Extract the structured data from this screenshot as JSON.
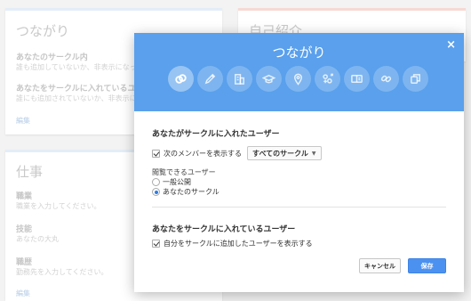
{
  "background": {
    "connections_card": {
      "title": "つながり",
      "sections": [
        {
          "heading": "あなたのサークル内",
          "sub": "誰も追加していないか、非表示になっています"
        },
        {
          "heading": "あなたをサークルに入れているユーザー",
          "sub": "誰にも追加されていないか、非表示になっています"
        }
      ],
      "edit": "編集"
    },
    "intro_card": {
      "title": "自己紹介"
    },
    "work_card": {
      "title": "仕事",
      "fields": [
        {
          "label": "職業",
          "value": "職業を入力してください。"
        },
        {
          "label": "技能",
          "value": "あなたの大丸"
        },
        {
          "label": "職歴",
          "value": "勤務先を入力してください。"
        }
      ],
      "edit": "編集"
    }
  },
  "modal": {
    "title": "つながり",
    "close": "×",
    "icons": [
      "link-icon",
      "pencil-icon",
      "building-icon",
      "graduation-cap-icon",
      "map-pin-icon",
      "gender-icon",
      "id-card-icon",
      "chain-icon",
      "copy-icon"
    ],
    "section1": {
      "heading": "あなたがサークルに入れたユーザー",
      "show_members_label": "次のメンバーを表示する",
      "select_value": "すべてのサークル",
      "viewers_label": "閲覧できるユーザー",
      "radio_options": [
        "一般公開",
        "あなたのサークル"
      ],
      "selected_radio": 1
    },
    "section2": {
      "heading": "あなたをサークルに入れているユーザー",
      "show_adders_label": "自分をサークルに追加したユーザーを表示する"
    },
    "buttons": {
      "cancel": "キャンセル",
      "save": "保存"
    }
  },
  "colors": {
    "header": "#5aa0ec",
    "save": "#4b91f0",
    "accent_radio": "#2b7de9"
  }
}
